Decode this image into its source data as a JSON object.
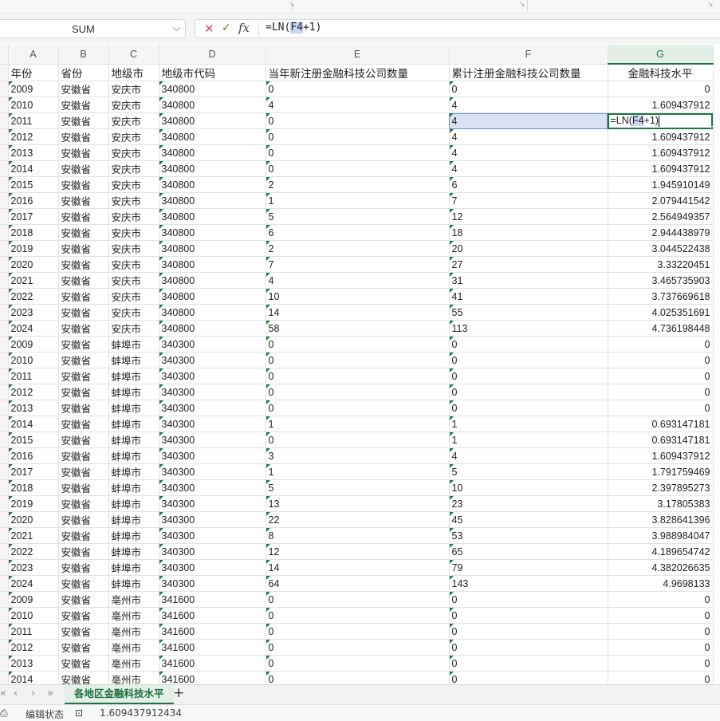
{
  "namebox": {
    "value": "SUM"
  },
  "formula_bar": {
    "formula_prefix": "=LN(",
    "formula_ref": "F4",
    "formula_suffix": "+1)"
  },
  "columns": [
    "A",
    "B",
    "C",
    "D",
    "E",
    "F",
    "G"
  ],
  "headers": [
    "年份",
    "省份",
    "地级市",
    "地级市代码",
    "当年新注册金融科技公司数量",
    "累计注册金融科技公司数量",
    "金融科技水平"
  ],
  "row_numbers": [
    "",
    "",
    "",
    "",
    "",
    "",
    "",
    "",
    "",
    "",
    "",
    "",
    "",
    "",
    "",
    "",
    "",
    "",
    "",
    "",
    "",
    "",
    "",
    "",
    "",
    "",
    "",
    "",
    "",
    "",
    "",
    "",
    "",
    "",
    "",
    "",
    "",
    "",
    ""
  ],
  "rows": [
    [
      "2009",
      "安徽省",
      "安庆市",
      "340800",
      "0",
      "0",
      "0"
    ],
    [
      "2010",
      "安徽省",
      "安庆市",
      "340800",
      "4",
      "4",
      "1.609437912"
    ],
    [
      "2011",
      "安徽省",
      "安庆市",
      "340800",
      "0",
      "4",
      ""
    ],
    [
      "2012",
      "安徽省",
      "安庆市",
      "340800",
      "0",
      "4",
      "1.609437912"
    ],
    [
      "2013",
      "安徽省",
      "安庆市",
      "340800",
      "0",
      "4",
      "1.609437912"
    ],
    [
      "2014",
      "安徽省",
      "安庆市",
      "340800",
      "0",
      "4",
      "1.609437912"
    ],
    [
      "2015",
      "安徽省",
      "安庆市",
      "340800",
      "2",
      "6",
      "1.945910149"
    ],
    [
      "2016",
      "安徽省",
      "安庆市",
      "340800",
      "1",
      "7",
      "2.079441542"
    ],
    [
      "2017",
      "安徽省",
      "安庆市",
      "340800",
      "5",
      "12",
      "2.564949357"
    ],
    [
      "2018",
      "安徽省",
      "安庆市",
      "340800",
      "6",
      "18",
      "2.944438979"
    ],
    [
      "2019",
      "安徽省",
      "安庆市",
      "340800",
      "2",
      "20",
      "3.044522438"
    ],
    [
      "2020",
      "安徽省",
      "安庆市",
      "340800",
      "7",
      "27",
      "3.33220451"
    ],
    [
      "2021",
      "安徽省",
      "安庆市",
      "340800",
      "4",
      "31",
      "3.465735903"
    ],
    [
      "2022",
      "安徽省",
      "安庆市",
      "340800",
      "10",
      "41",
      "3.737669618"
    ],
    [
      "2023",
      "安徽省",
      "安庆市",
      "340800",
      "14",
      "55",
      "4.025351691"
    ],
    [
      "2024",
      "安徽省",
      "安庆市",
      "340800",
      "58",
      "113",
      "4.736198448"
    ],
    [
      "2009",
      "安徽省",
      "蚌埠市",
      "340300",
      "0",
      "0",
      "0"
    ],
    [
      "2010",
      "安徽省",
      "蚌埠市",
      "340300",
      "0",
      "0",
      "0"
    ],
    [
      "2011",
      "安徽省",
      "蚌埠市",
      "340300",
      "0",
      "0",
      "0"
    ],
    [
      "2012",
      "安徽省",
      "蚌埠市",
      "340300",
      "0",
      "0",
      "0"
    ],
    [
      "2013",
      "安徽省",
      "蚌埠市",
      "340300",
      "0",
      "0",
      "0"
    ],
    [
      "2014",
      "安徽省",
      "蚌埠市",
      "340300",
      "1",
      "1",
      "0.693147181"
    ],
    [
      "2015",
      "安徽省",
      "蚌埠市",
      "340300",
      "0",
      "1",
      "0.693147181"
    ],
    [
      "2016",
      "安徽省",
      "蚌埠市",
      "340300",
      "3",
      "4",
      "1.609437912"
    ],
    [
      "2017",
      "安徽省",
      "蚌埠市",
      "340300",
      "1",
      "5",
      "1.791759469"
    ],
    [
      "2018",
      "安徽省",
      "蚌埠市",
      "340300",
      "5",
      "10",
      "2.397895273"
    ],
    [
      "2019",
      "安徽省",
      "蚌埠市",
      "340300",
      "13",
      "23",
      "3.17805383"
    ],
    [
      "2020",
      "安徽省",
      "蚌埠市",
      "340300",
      "22",
      "45",
      "3.828641396"
    ],
    [
      "2021",
      "安徽省",
      "蚌埠市",
      "340300",
      "8",
      "53",
      "3.988984047"
    ],
    [
      "2022",
      "安徽省",
      "蚌埠市",
      "340300",
      "12",
      "65",
      "4.189654742"
    ],
    [
      "2023",
      "安徽省",
      "蚌埠市",
      "340300",
      "14",
      "79",
      "4.382026635"
    ],
    [
      "2024",
      "安徽省",
      "蚌埠市",
      "340300",
      "64",
      "143",
      "4.9698133"
    ],
    [
      "2009",
      "安徽省",
      "亳州市",
      "341600",
      "0",
      "0",
      "0"
    ],
    [
      "2010",
      "安徽省",
      "亳州市",
      "341600",
      "0",
      "0",
      "0"
    ],
    [
      "2011",
      "安徽省",
      "亳州市",
      "341600",
      "0",
      "0",
      "0"
    ],
    [
      "2012",
      "安徽省",
      "亳州市",
      "341600",
      "0",
      "0",
      "0"
    ],
    [
      "2013",
      "安徽省",
      "亳州市",
      "341600",
      "0",
      "0",
      "0"
    ],
    [
      "2014",
      "安徽省",
      "亳州市",
      "341600",
      "0",
      "0",
      "0"
    ]
  ],
  "editing_cell": {
    "prefix": "=LN(",
    "ref": "F4",
    "suffix": "+1)"
  },
  "sheet_tab": {
    "label": "各地区金融科技水平"
  },
  "tab_nav": {
    "first": "«",
    "prev": "‹",
    "next": "›",
    "last": "»",
    "add": "+"
  },
  "status": {
    "mode": "编辑状态",
    "value": "1.609437912434"
  },
  "icons": [
    "cancel-icon",
    "confirm-icon",
    "fx-icon",
    "dropdown-icon",
    "record-macro-icon",
    "accessibility-icon"
  ]
}
